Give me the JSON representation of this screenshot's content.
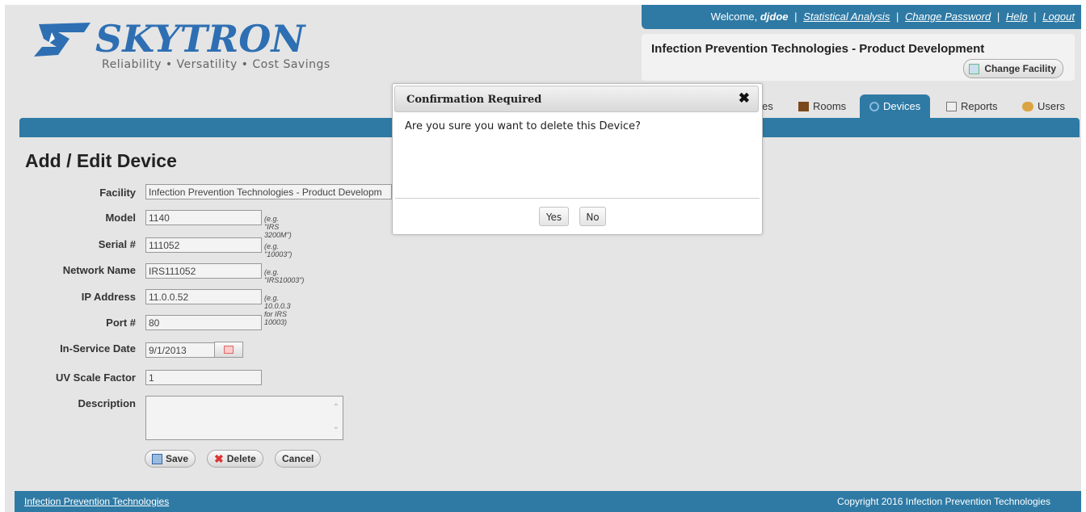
{
  "brand": {
    "name": "SKYTRON",
    "tagline": "Reliability • Versatility • Cost Savings",
    "primary_color": "#2e7aa5"
  },
  "toplinks": {
    "welcome": "Welcome,",
    "user": "djdoe",
    "links": [
      "Statistical Analysis",
      "Change Password",
      "Help",
      "Logout"
    ]
  },
  "facility": {
    "name": "Infection Prevention Technologies - Product Development",
    "change_label": "Change Facility"
  },
  "tabs": [
    {
      "label": "es"
    },
    {
      "label": "Rooms"
    },
    {
      "label": "Devices",
      "active": true
    },
    {
      "label": "Reports"
    },
    {
      "label": "Users"
    }
  ],
  "page": {
    "title": "Add / Edit Device"
  },
  "form": {
    "facility": {
      "label": "Facility",
      "value": "Infection Prevention Technologies - Product Developm"
    },
    "model": {
      "label": "Model",
      "value": "1140",
      "hint": "(e.g. \"IRS 3200M\")"
    },
    "serial": {
      "label": "Serial #",
      "value": "111052",
      "hint": "(e.g. \"10003\")"
    },
    "network": {
      "label": "Network Name",
      "value": "IRS111052",
      "hint": "(e.g. \"IRS10003\")"
    },
    "ip": {
      "label": "IP Address",
      "value": "11.0.0.52",
      "hint": "(e.g. 10.0.0.3 for IRS 10003)"
    },
    "port": {
      "label": "Port #",
      "value": "80"
    },
    "inservice": {
      "label": "In-Service Date",
      "value": "9/1/2013"
    },
    "uvscale": {
      "label": "UV Scale Factor",
      "value": "1"
    },
    "description": {
      "label": "Description",
      "value": ""
    }
  },
  "buttons": {
    "save": "Save",
    "delete": "Delete",
    "cancel": "Cancel"
  },
  "modal": {
    "title": "Confirmation Required",
    "close": "✖",
    "message": "Are you sure you want to delete this Device?",
    "yes": "Yes",
    "no": "No"
  },
  "footer": {
    "left": "Infection Prevention Technologies",
    "right": "Copyright 2016 Infection Prevention Technologies"
  }
}
